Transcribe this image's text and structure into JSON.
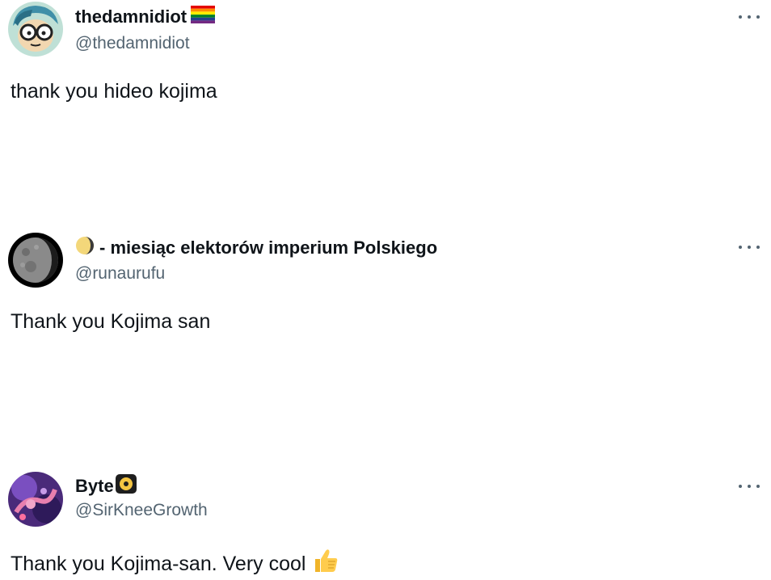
{
  "tweets": [
    {
      "display_name": "thedamnidiot",
      "handle": "@thedamnidiot",
      "text": "thank you hideo kojima",
      "name_emoji": "rainbow-flag-icon",
      "avatar": "cartoon-glasses-avatar"
    },
    {
      "display_name_prefix_emoji": "crescent-moon-icon",
      "display_name": "- miesiąc elektorów imperium Polskiego",
      "handle": "@runaurufu",
      "text": "Thank you Kojima san",
      "avatar": "moon-avatar"
    },
    {
      "display_name": "Byte",
      "name_emoji": "badge-icon",
      "handle": "@SirKneeGrowth",
      "text": "Thank you Kojima-san. Very cool",
      "text_emoji": "thumbs-up-icon",
      "avatar": "purple-abstract-avatar"
    }
  ],
  "colors": {
    "text": "#0f1419",
    "secondary": "#536471",
    "background": "#ffffff"
  }
}
